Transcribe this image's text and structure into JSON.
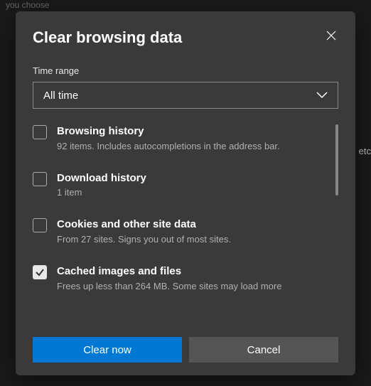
{
  "background": {
    "topText": "you choose",
    "rightText": "etc"
  },
  "dialog": {
    "title": "Clear browsing data",
    "timeRange": {
      "label": "Time range",
      "value": "All time"
    },
    "options": [
      {
        "checked": false,
        "title": "Browsing history",
        "desc": "92 items. Includes autocompletions in the address bar."
      },
      {
        "checked": false,
        "title": "Download history",
        "desc": "1 item"
      },
      {
        "checked": false,
        "title": "Cookies and other site data",
        "desc": "From 27 sites. Signs you out of most sites."
      },
      {
        "checked": true,
        "title": "Cached images and files",
        "desc": "Frees up less than 264 MB. Some sites may load more"
      }
    ],
    "buttons": {
      "primary": "Clear now",
      "secondary": "Cancel"
    }
  }
}
